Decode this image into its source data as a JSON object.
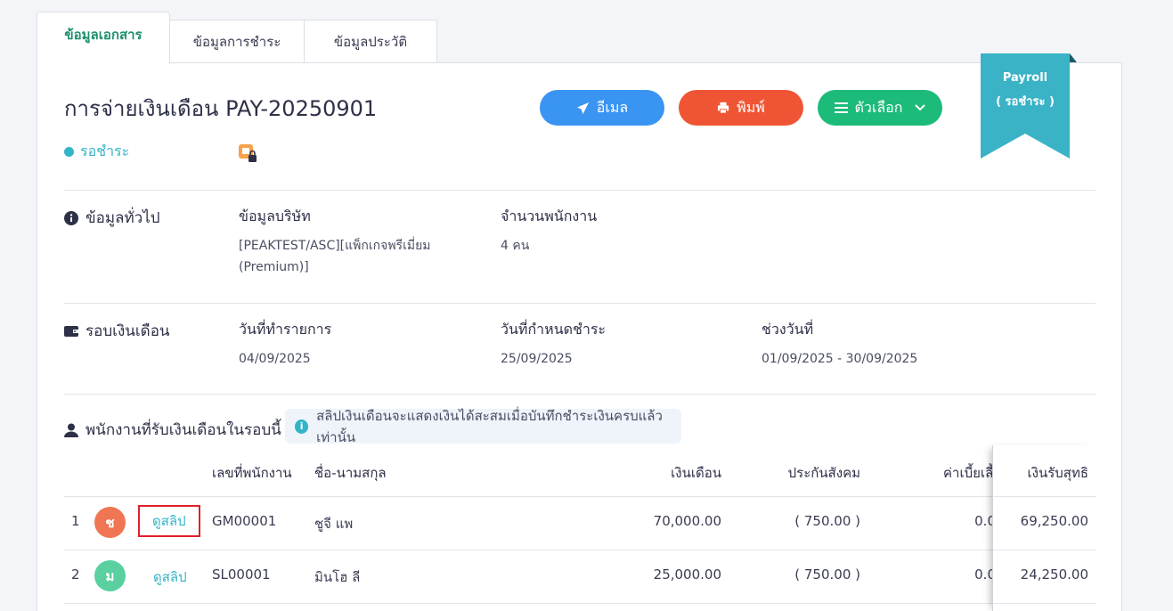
{
  "tabs": [
    {
      "label": "ข้อมูลเอกสาร",
      "active": true
    },
    {
      "label": "ข้อมูลการชำระ",
      "active": false
    },
    {
      "label": "ข้อมูลประวัติ",
      "active": false
    }
  ],
  "document": {
    "title": "การจ่ายเงินเดือน PAY-20250901",
    "status": "รอชำระ"
  },
  "actions": {
    "email": "อีเมล",
    "print": "พิมพ์",
    "options": "ตัวเลือก"
  },
  "ribbon": {
    "line1": "Payroll",
    "line2": "( รอชำระ )"
  },
  "general": {
    "section_label": "ข้อมูลทั่วไป",
    "company_label": "ข้อมูลบริษัท",
    "company_value_1": "[PEAKTEST/ASC][แพ็กเกจพรีเมี่ยม",
    "company_value_2": "(Premium)]",
    "employee_count_label": "จำนวนพนักงาน",
    "employee_count_value": "4 คน"
  },
  "cycle": {
    "section_label": "รอบเงินเดือน",
    "transaction_date_label": "วันที่ทำรายการ",
    "transaction_date_value": "04/09/2025",
    "due_date_label": "วันที่กำหนดชำระ",
    "due_date_value": "25/09/2025",
    "period_label": "ช่วงวันที่",
    "period_value": "01/09/2025 - 30/09/2025"
  },
  "employees": {
    "section_label": "พนักงานที่รับเงินเดือนในรอบนี้",
    "info_note": "สลิปเงินเดือนจะแสดงเงินได้สะสมเมื่อบันทึกชำระเงินครบแล้วเท่านั้น",
    "info_icon": "i",
    "columns": {
      "employee_id": "เลขที่พนักงาน",
      "name": "ชื่อ-นามสกุล",
      "salary": "เงินเดือน",
      "social_security": "ประกันสังคม",
      "allowance": "ค่าเบี้ยเลี้ย",
      "net": "เงินรับสุทธิ"
    },
    "rows": [
      {
        "no": "1",
        "avatar": "ช",
        "avatar_color": "#f07552",
        "slip": "ดูสลิป",
        "employee_id": "GM00001",
        "name": "ชูจี แพ",
        "salary": "70,000.00",
        "social_security": "( 750.00 )",
        "allowance": "0.0",
        "net": "69,250.00"
      },
      {
        "no": "2",
        "avatar": "ม",
        "avatar_color": "#5ad0a0",
        "slip": "ดูสลิป",
        "employee_id": "SL00001",
        "name": "มินโฮ ลี",
        "salary": "25,000.00",
        "social_security": "( 750.00 )",
        "allowance": "0.0",
        "net": "24,250.00"
      }
    ]
  }
}
